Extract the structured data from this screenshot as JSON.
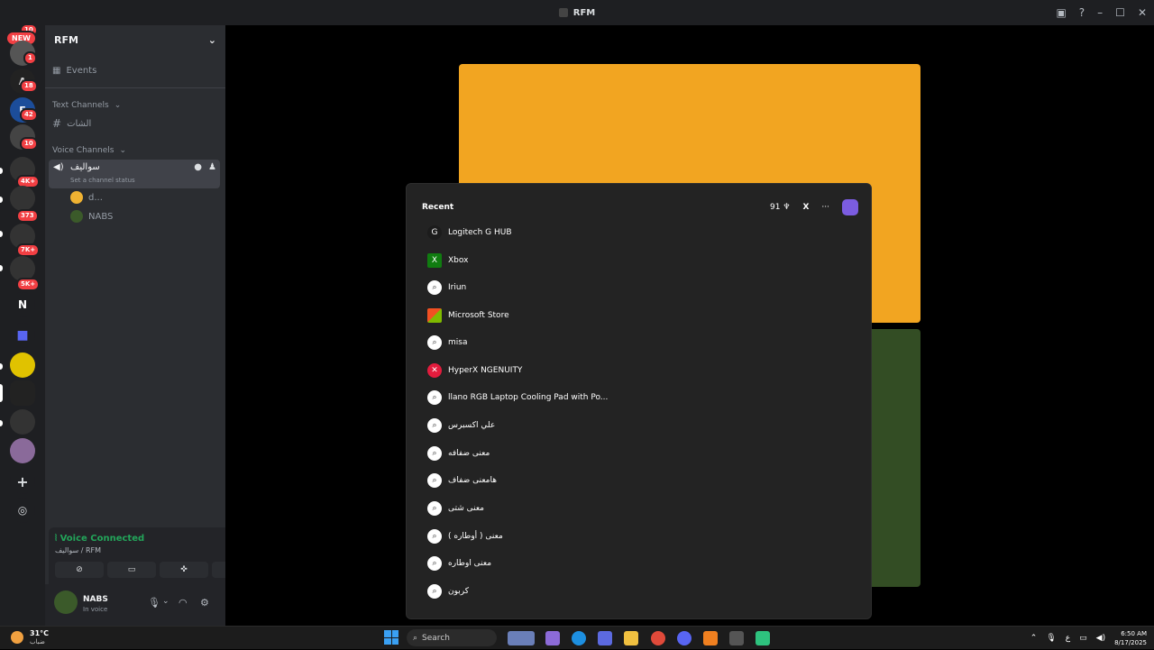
{
  "window": {
    "title": "RFM"
  },
  "rail": {
    "new_badge": "NEW",
    "top_badge": "10",
    "badges": [
      "1",
      "18",
      "42",
      "10",
      "4K+",
      "373",
      "7K+",
      "5K+"
    ],
    "letter_server": "N"
  },
  "guild": {
    "name": "RFM",
    "events_label": "Events",
    "text_category": "Text Channels",
    "text_channel": "الشات",
    "voice_category": "Voice Channels",
    "voice_channel": "سواليف",
    "channel_status_placeholder": "Set a channel status",
    "members": [
      {
        "name": "d..."
      },
      {
        "name": "NABS"
      }
    ]
  },
  "voice_panel": {
    "status": "Voice Connected",
    "location": "سواليف / RFM"
  },
  "user": {
    "name": "NABS",
    "status": "In voice"
  },
  "start_menu": {
    "heading": "Recent",
    "points": "91",
    "letter": "X",
    "items": [
      {
        "label": "Logitech G HUB",
        "icon": "G"
      },
      {
        "label": "Xbox",
        "icon": "X"
      },
      {
        "label": "Iriun",
        "icon": "search"
      },
      {
        "label": "Microsoft Store",
        "icon": "store"
      },
      {
        "label": "misa",
        "icon": "search"
      },
      {
        "label": "HyperX NGENUITY",
        "icon": "hyperx"
      },
      {
        "label": "llano RGB Laptop Cooling Pad with Po...",
        "icon": "search"
      },
      {
        "label": "علي اكسبرس",
        "icon": "search"
      },
      {
        "label": "معنى ضفافه",
        "icon": "search"
      },
      {
        "label": "هامعنى ضفاف",
        "icon": "search"
      },
      {
        "label": "معنى شتى",
        "icon": "search"
      },
      {
        "label": "معنى ( أوطاره )",
        "icon": "search"
      },
      {
        "label": "معنى اوطاره",
        "icon": "search"
      },
      {
        "label": "كربون",
        "icon": "search"
      }
    ]
  },
  "taskbar": {
    "temperature": "31°C",
    "weather": "ضباب",
    "search_placeholder": "Search",
    "lang": "ع",
    "time": "6:50 AM",
    "date": "8/17/2025"
  },
  "colors": {
    "orange_tile": "#f2a521",
    "green_tile": "#334d24",
    "voice_green": "#23a55a"
  }
}
